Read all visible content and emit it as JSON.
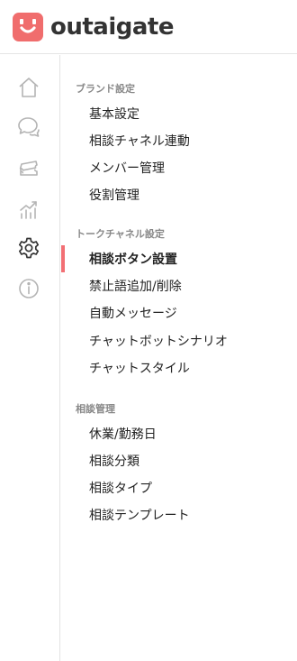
{
  "brand": {
    "name": "outaigate",
    "accent_color": "#f06d6d"
  },
  "rail": {
    "items": [
      {
        "icon": "home-icon",
        "active": false
      },
      {
        "icon": "chat-bubbles-icon",
        "active": false
      },
      {
        "icon": "tickets-icon",
        "active": false
      },
      {
        "icon": "analytics-icon",
        "active": false
      },
      {
        "icon": "gear-icon",
        "active": true
      },
      {
        "icon": "info-icon",
        "active": false
      }
    ]
  },
  "nav": {
    "active_color": "#f26f74",
    "sections": [
      {
        "title": "ブランド設定",
        "items": [
          {
            "label": "基本設定"
          },
          {
            "label": "相談チャネル連動"
          },
          {
            "label": "メンバー管理"
          },
          {
            "label": "役割管理"
          }
        ]
      },
      {
        "title": "トークチャネル設定",
        "items": [
          {
            "label": "相談ボタン設置",
            "active": true
          },
          {
            "label": "禁止語追加/削除"
          },
          {
            "label": "自動メッセージ"
          },
          {
            "label": "チャットボットシナリオ"
          },
          {
            "label": "チャットスタイル"
          }
        ]
      },
      {
        "title": "相談管理",
        "items": [
          {
            "label": "休業/勤務日"
          },
          {
            "label": "相談分類"
          },
          {
            "label": "相談タイプ"
          },
          {
            "label": "相談テンプレート"
          }
        ]
      }
    ]
  }
}
